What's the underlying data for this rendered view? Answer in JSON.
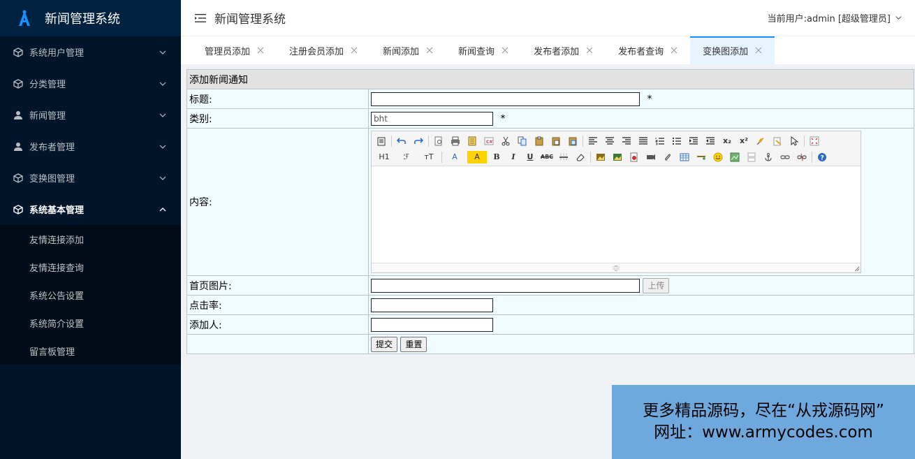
{
  "app": {
    "title": "新闻管理系统"
  },
  "header": {
    "title": "新闻管理系统",
    "user": "当前用户:admin [超级管理员]"
  },
  "sidebar": {
    "items": [
      {
        "label": "系统用户管理",
        "icon": "cube-icon"
      },
      {
        "label": "分类管理",
        "icon": "cube-icon"
      },
      {
        "label": "新闻管理",
        "icon": "user-icon"
      },
      {
        "label": "发布者管理",
        "icon": "user-icon"
      },
      {
        "label": "变换图管理",
        "icon": "cube-icon"
      },
      {
        "label": "系统基本管理",
        "icon": "cube-icon",
        "open": true
      }
    ],
    "submenu": [
      "友情连接添加",
      "友情连接查询",
      "系统公告设置",
      "系统简介设置",
      "留言板管理"
    ]
  },
  "tabs": [
    {
      "label": "管理员添加"
    },
    {
      "label": "注册会员添加"
    },
    {
      "label": "新闻添加"
    },
    {
      "label": "新闻查询"
    },
    {
      "label": "发布者添加"
    },
    {
      "label": "发布者查询"
    },
    {
      "label": "变换图添加",
      "active": true
    }
  ],
  "form": {
    "caption": "添加新闻通知",
    "title_label": "标题:",
    "title_value": "",
    "category_label": "类别:",
    "category_value": "bht",
    "content_label": "内容:",
    "image_label": "首页图片:",
    "image_value": "",
    "upload_label": "上传",
    "clicks_label": "点击率:",
    "clicks_value": "",
    "adder_label": "添加人:",
    "adder_value": "",
    "submit_label": "提交",
    "reset_label": "重置",
    "required_mark": "*"
  },
  "editor": {
    "heading_label": "H1",
    "font_label": "ℱ",
    "size_label": "тT",
    "fontcolor_label": "A",
    "highlight_label": "A",
    "bold_label": "B",
    "italic_label": "I",
    "underline_label": "U",
    "strike_label": "ABC",
    "subscript_label": "x₂",
    "superscript_label": "x²",
    "help_label": "?"
  },
  "watermark": {
    "line1": "更多精品源码，尽在“从戎源码网”",
    "line2": "网址：www.armycodes.com"
  },
  "colors": {
    "sidebar_bg": "#001529",
    "accent": "#1890ff",
    "form_bg": "#f0fcff",
    "watermark_bg": "#6fa8dc"
  }
}
